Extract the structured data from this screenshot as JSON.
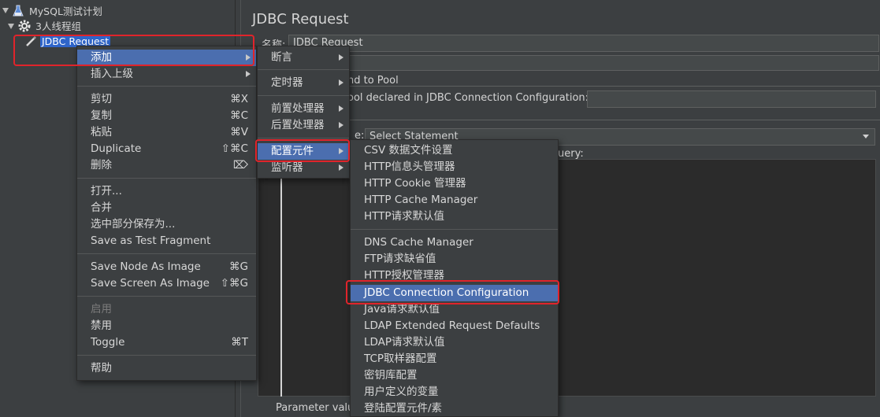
{
  "tree": {
    "plan": "MySQL测试计划",
    "thread_group": "3人线程组",
    "selected": "JDBC Request"
  },
  "editor": {
    "title": "JDBC Request",
    "name_label": "名称:",
    "name_value": "JDBC Request",
    "pool_label": "nd to Pool",
    "pool_declared": "ool declared in JDBC Connection Configuration:",
    "type_label": "e:",
    "type_value": "Select Statement",
    "query_label": "uery:",
    "param_label": "Parameter valu"
  },
  "menu": {
    "items": [
      {
        "label": "添加",
        "submenu": true,
        "selected": true
      },
      {
        "label": "插入上级",
        "submenu": true
      },
      {
        "label": "剪切",
        "shortcut": "⌘X"
      },
      {
        "label": "复制",
        "shortcut": "⌘C"
      },
      {
        "label": "粘贴",
        "shortcut": "⌘V"
      },
      {
        "label": "Duplicate",
        "shortcut": "⇧⌘C"
      },
      {
        "label": "删除",
        "shortcut": "⌦"
      },
      {
        "label": "打开..."
      },
      {
        "label": "合并"
      },
      {
        "label": "选中部分保存为..."
      },
      {
        "label": "Save as Test Fragment"
      },
      {
        "label": "Save Node As Image",
        "shortcut": "⌘G"
      },
      {
        "label": "Save Screen As Image",
        "shortcut": "⇧⌘G"
      },
      {
        "label": "启用",
        "disabled": true
      },
      {
        "label": "禁用"
      },
      {
        "label": "Toggle",
        "shortcut": "⌘T"
      },
      {
        "label": "帮助"
      }
    ]
  },
  "submenu": {
    "items": [
      {
        "label": "断言",
        "submenu": true
      },
      {
        "label": "定时器",
        "submenu": true
      },
      {
        "label": "前置处理器",
        "submenu": true
      },
      {
        "label": "后置处理器",
        "submenu": true
      },
      {
        "label": "配置元件",
        "submenu": true,
        "selected": true
      },
      {
        "label": "监听器",
        "submenu": true
      }
    ]
  },
  "config_menu": {
    "items": [
      {
        "label": "CSV 数据文件设置"
      },
      {
        "label": "HTTP信息头管理器"
      },
      {
        "label": "HTTP Cookie 管理器"
      },
      {
        "label": "HTTP Cache Manager"
      },
      {
        "label": "HTTP请求默认值"
      },
      {
        "label": "DNS Cache Manager"
      },
      {
        "label": "FTP请求缺省值"
      },
      {
        "label": "HTTP授权管理器"
      },
      {
        "label": "JDBC Connection Configuration",
        "selected": true
      },
      {
        "label": "Java请求默认值"
      },
      {
        "label": "LDAP Extended Request Defaults"
      },
      {
        "label": "LDAP请求默认值"
      },
      {
        "label": "TCP取样器配置"
      },
      {
        "label": "密钥库配置"
      },
      {
        "label": "用户定义的变量"
      },
      {
        "label": "登陆配置元件/素"
      }
    ]
  },
  "colors": {
    "background": "#3c3f41",
    "selection": "#4b6eaf",
    "highlight_border": "#e0242b",
    "tree_selection": "#2f65ca"
  }
}
